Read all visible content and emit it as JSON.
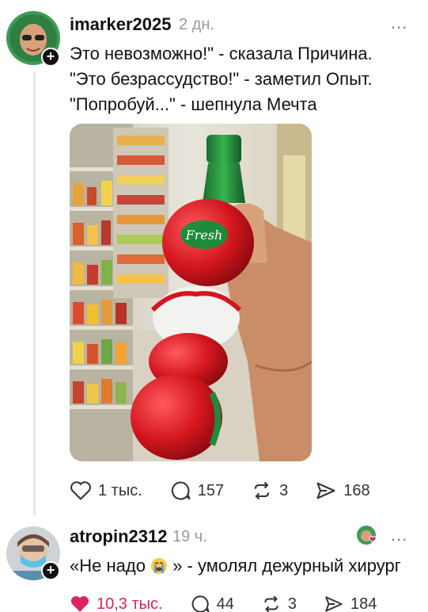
{
  "post": {
    "username": "imarker2025",
    "time": "2 дн.",
    "more_label": "...",
    "text": "Это невозможно!\" - сказала Причина.\n\"Это безрассудство!\" - заметил Опыт.\n\"Попробуй...\" - шепнула Мечта",
    "image": {
      "product_label": "Fresh"
    },
    "actions": {
      "likes": "1 тыс.",
      "comments": "157",
      "reposts": "3",
      "shares": "168"
    }
  },
  "comment": {
    "username": "atropin2312",
    "time": "19 ч.",
    "more_label": "...",
    "text_before": "«Не надо",
    "text_after": "» - умолял дежурный хирург",
    "actions": {
      "likes": "10,3 тыс.",
      "comments": "44",
      "reposts": "3",
      "shares": "184"
    }
  },
  "colors": {
    "like_active": "#e0245e",
    "bottle_green": "#1f8a3a",
    "bottle_red": "#d4161f"
  },
  "icons": [
    "plus-icon",
    "heart-icon",
    "comment-icon",
    "repost-icon",
    "share-icon",
    "more-icon",
    "crying-emoji-icon"
  ]
}
